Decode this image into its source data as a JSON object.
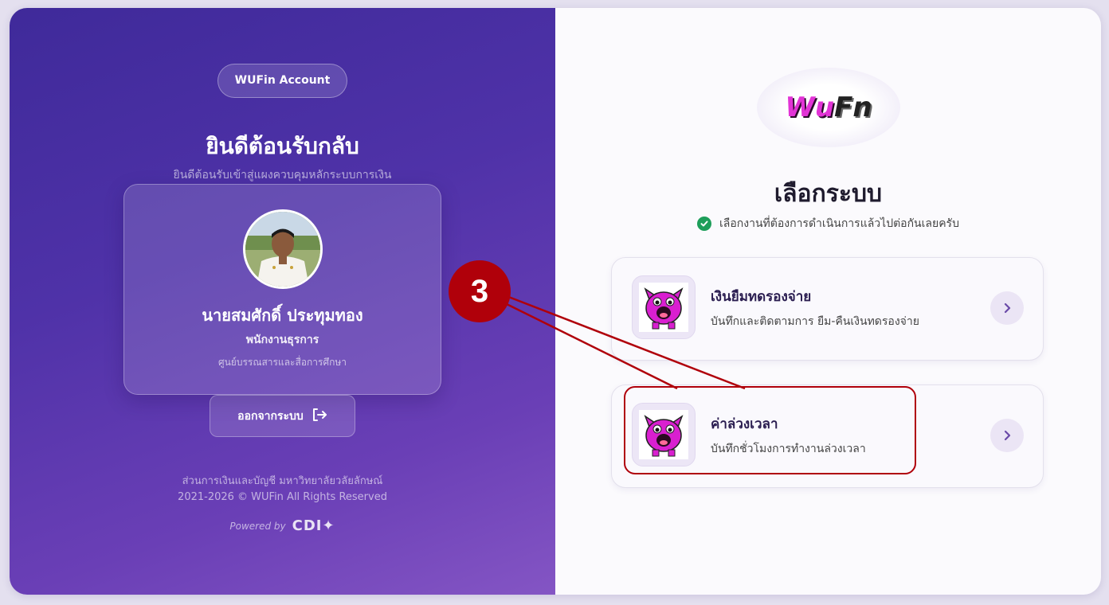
{
  "left_panel": {
    "badge": "WUFin Account",
    "welcome_title": "ยินดีต้อนรับกลับ",
    "welcome_subtitle": "ยินดีต้อนรับเข้าสู่แผงควบคุมหลักระบบการเงิน",
    "profile": {
      "name": "นายสมศักดิ์ ประทุมทอง",
      "role": "พนักงานธุรการ",
      "department": "ศูนย์บรรณสารและสื่อการศึกษา"
    },
    "logout_label": "ออกจากระบบ",
    "footer": {
      "org": "ส่วนการเงินและบัญชี มหาวิทยาลัยวลัยลักษณ์",
      "copyright": "2021-2026 © WUFin All Rights Reserved",
      "powered_by": "Powered by",
      "powered_logo": "CDI"
    }
  },
  "right_panel": {
    "brand_logo": {
      "part1": "Wu",
      "part2": "Fn"
    },
    "title": "เลือกระบบ",
    "subtitle": "เลือกงานที่ต้องการดำเนินการแล้วไปต่อกันเลยครับ",
    "systems": [
      {
        "title": "เงินยืมทดรองจ่าย",
        "description": "บันทึกและติดตามการ ยืม-คืนเงินทดรองจ่าย",
        "icon": "pig-mascot-icon"
      },
      {
        "title": "ค่าล่วงเวลา",
        "description": "บันทึกชั่วโมงการทำงานล่วงเวลา",
        "icon": "pig-mascot-icon"
      }
    ]
  },
  "annotation": {
    "step_number": "3",
    "color": "#b0000a"
  },
  "colors": {
    "accent": "#4f32a8",
    "brand_pink": "#e233d6",
    "success": "#1e9e5a"
  }
}
